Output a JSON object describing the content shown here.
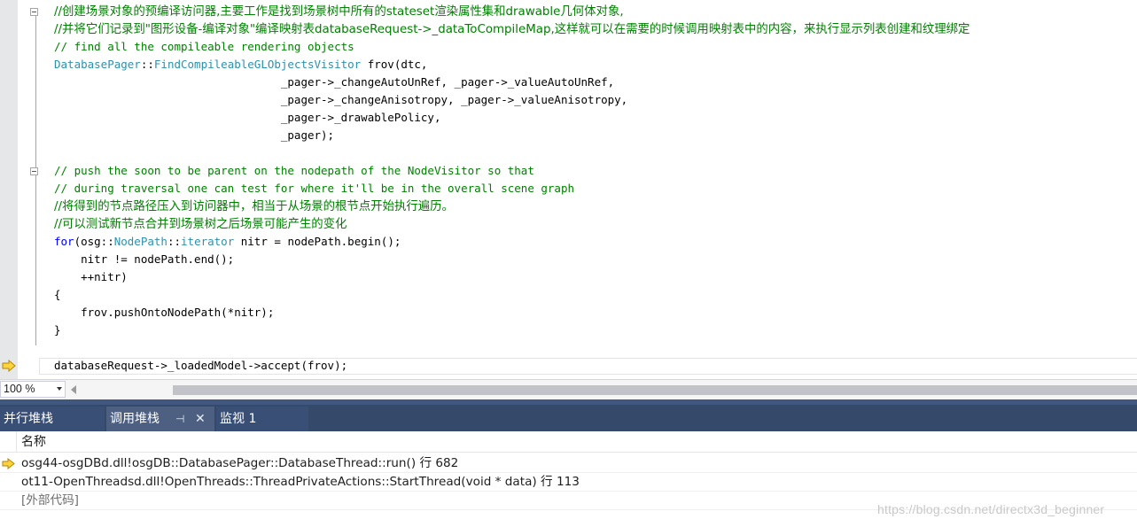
{
  "editor": {
    "lines": [
      {
        "segs": [
          {
            "c": "cm-cjk",
            "t": "//创建场景对象的预编译访问器,主要工作是找到场景树中所有的stateset渲染属性集和drawable几何体对象,"
          }
        ]
      },
      {
        "segs": [
          {
            "c": "cm-cjk",
            "t": "//并将它们记录到\"图形设备-编译对象\"编译映射表databaseRequest->_dataToCompileMap,这样就可以在需要的时候调用映射表中的内容，来执行显示列表创建和纹理绑定"
          }
        ]
      },
      {
        "segs": [
          {
            "c": "cm",
            "t": "// find all the compileable rendering objects"
          }
        ]
      },
      {
        "segs": [
          {
            "c": "ty",
            "t": "DatabasePager"
          },
          {
            "c": "",
            "t": "::"
          },
          {
            "c": "ty",
            "t": "FindCompileableGLObjectsVisitor"
          },
          {
            "c": "",
            "t": " frov(dtc,"
          }
        ]
      },
      {
        "segs": [
          {
            "c": "",
            "t": "                                  _pager->_changeAutoUnRef, _pager->_valueAutoUnRef,"
          }
        ]
      },
      {
        "segs": [
          {
            "c": "",
            "t": "                                  _pager->_changeAnisotropy, _pager->_valueAnisotropy,"
          }
        ]
      },
      {
        "segs": [
          {
            "c": "",
            "t": "                                  _pager->_drawablePolicy,"
          }
        ]
      },
      {
        "segs": [
          {
            "c": "",
            "t": "                                  _pager);"
          }
        ]
      },
      {
        "segs": [
          {
            "c": "",
            "t": ""
          }
        ]
      },
      {
        "segs": [
          {
            "c": "cm",
            "t": "// push the soon to be parent on the nodepath of the NodeVisitor so that"
          }
        ]
      },
      {
        "segs": [
          {
            "c": "cm",
            "t": "// during traversal one can test for where it'll be in the overall scene graph"
          }
        ]
      },
      {
        "segs": [
          {
            "c": "cm-cjk",
            "t": "//将得到的节点路径压入到访问器中，相当于从场景的根节点开始执行遍历。"
          }
        ]
      },
      {
        "segs": [
          {
            "c": "cm-cjk",
            "t": "//可以测试新节点合并到场景树之后场景可能产生的变化"
          }
        ]
      },
      {
        "segs": [
          {
            "c": "kw",
            "t": "for"
          },
          {
            "c": "",
            "t": "(osg::"
          },
          {
            "c": "ty",
            "t": "NodePath"
          },
          {
            "c": "",
            "t": "::"
          },
          {
            "c": "ty",
            "t": "iterator"
          },
          {
            "c": "",
            "t": " nitr = nodePath.begin();"
          }
        ]
      },
      {
        "segs": [
          {
            "c": "",
            "t": "    nitr != nodePath.end();"
          }
        ]
      },
      {
        "segs": [
          {
            "c": "",
            "t": "    ++nitr)"
          }
        ]
      },
      {
        "segs": [
          {
            "c": "",
            "t": "{"
          }
        ]
      },
      {
        "segs": [
          {
            "c": "",
            "t": "    frov.pushOntoNodePath(*nitr);"
          }
        ]
      },
      {
        "segs": [
          {
            "c": "",
            "t": "}"
          }
        ]
      },
      {
        "segs": [
          {
            "c": "",
            "t": ""
          }
        ]
      },
      {
        "segs": [
          {
            "c": "",
            "t": "databaseRequest->_loadedModel->accept(frov);"
          }
        ]
      }
    ]
  },
  "statusbar": {
    "zoom": "100 %"
  },
  "tabs": {
    "parallel_stacks": "并行堆栈",
    "call_stack": "调用堆栈",
    "watch": "监视 1",
    "pin_glyph": "⊣",
    "close_glyph": "✕"
  },
  "callstack": {
    "column_name": "名称",
    "rows": [
      {
        "text": "osg44-osgDBd.dll!osgDB::DatabasePager::DatabaseThread::run() 行 682",
        "current": true
      },
      {
        "text": "ot11-OpenThreadsd.dll!OpenThreads::ThreadPrivateActions::StartThread(void * data) 行 113",
        "current": false
      },
      {
        "text": "[外部代码]",
        "current": false
      }
    ]
  },
  "watermark": "https://blog.csdn.net/directx3d_beginner",
  "colors": {
    "keyword": "#0000ff",
    "type": "#2b91af",
    "comment": "#008000",
    "tab_active": "#4d6082",
    "tab_bar": "#35496a"
  }
}
